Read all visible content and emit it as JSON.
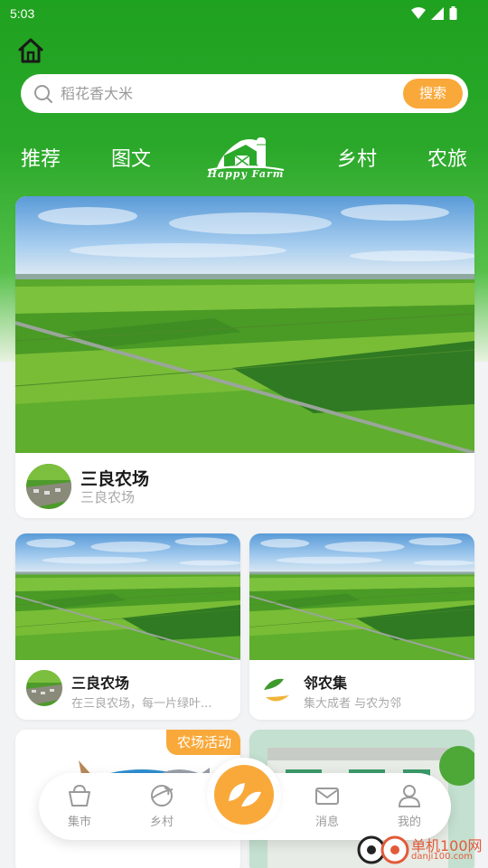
{
  "status_bar": {
    "time": "5:03"
  },
  "search": {
    "placeholder": "稻花香大米",
    "button_label": "搜索"
  },
  "nav_tabs": [
    {
      "label": "推荐"
    },
    {
      "label": "图文"
    },
    {
      "label": "乡村"
    },
    {
      "label": "农旅"
    }
  ],
  "logo_text": "Happy Farm",
  "featured": {
    "title": "三良农场",
    "subtitle": "三良农场"
  },
  "grid_cards": [
    {
      "title": "三良农场",
      "subtitle": "在三良农场，每一片绿叶..."
    },
    {
      "title": "邻农集",
      "subtitle": "集大成者 与农为邻"
    }
  ],
  "activity_badge": "农场活动",
  "bottom_nav": [
    {
      "label": "集市",
      "icon": "basket-icon"
    },
    {
      "label": "乡村",
      "icon": "leaf-planet-icon"
    },
    {
      "label": "消息",
      "icon": "mail-icon"
    },
    {
      "label": "我的",
      "icon": "person-icon"
    }
  ],
  "watermark": {
    "main": "单机100网",
    "sub": "danji100.com"
  },
  "colors": {
    "primary_green": "#1fa21f",
    "accent_orange": "#f9a93a"
  }
}
